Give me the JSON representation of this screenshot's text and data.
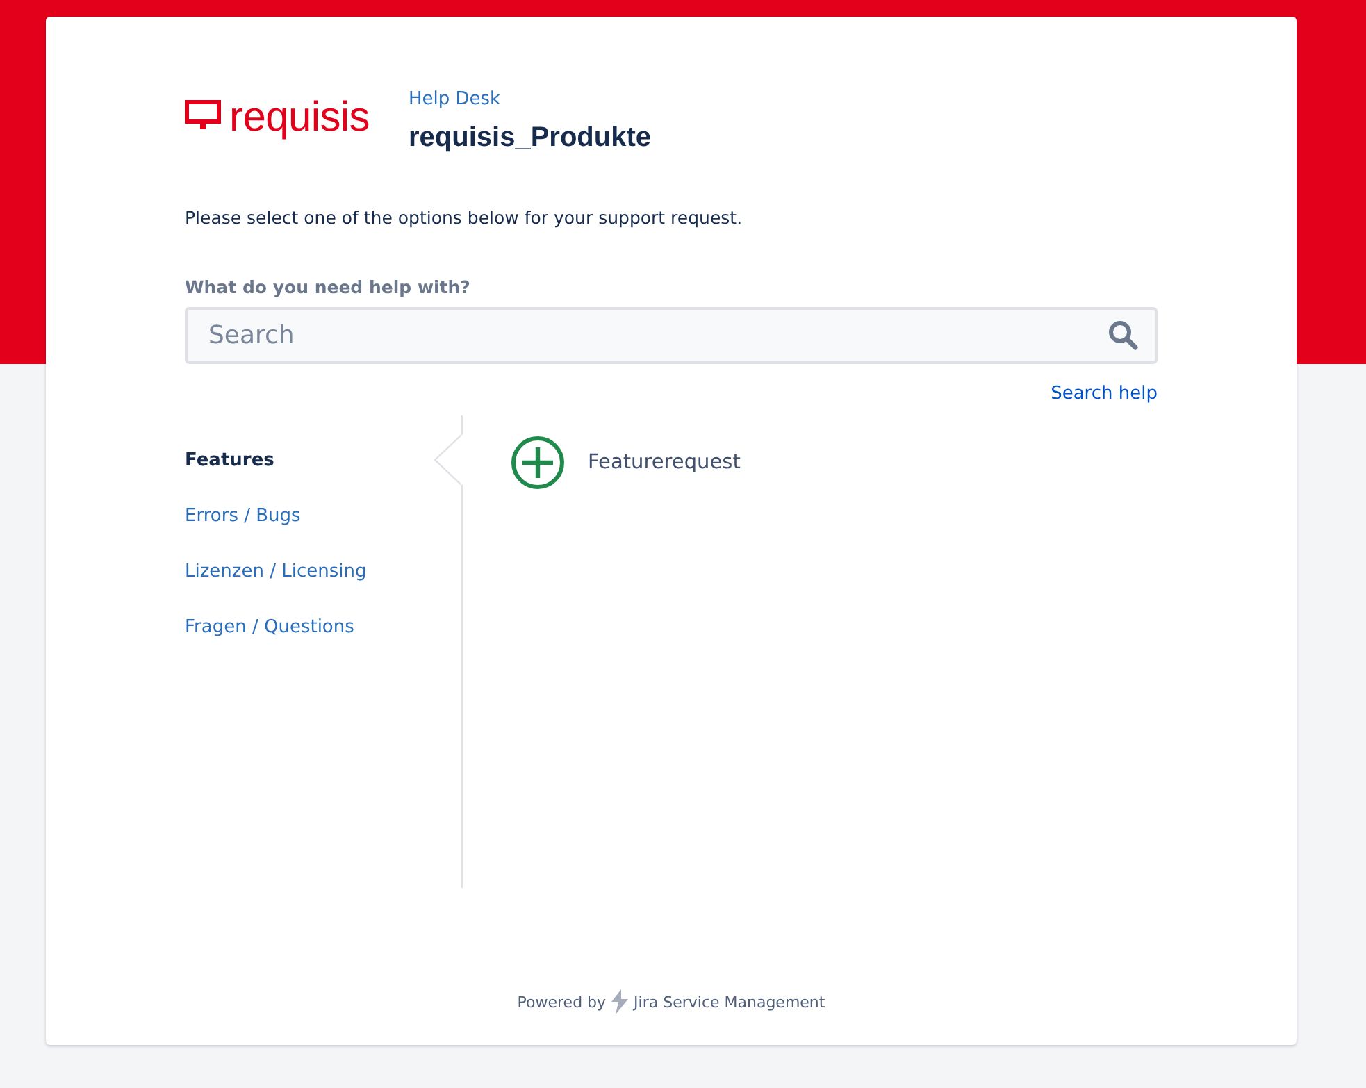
{
  "logo": {
    "text": "requisis"
  },
  "header": {
    "breadcrumb": "Help Desk",
    "title": "requisis_Produkte"
  },
  "intro": "Please select one of the options below for your support request.",
  "search": {
    "label": "What do you need help with?",
    "placeholder": "Search",
    "help_link": "Search help"
  },
  "sidebar": {
    "items": [
      {
        "label": "Features",
        "selected": true
      },
      {
        "label": "Errors / Bugs",
        "selected": false
      },
      {
        "label": "Lizenzen / Licensing",
        "selected": false
      },
      {
        "label": "Fragen / Questions",
        "selected": false
      }
    ]
  },
  "request_types": [
    {
      "label": "Featurerequest",
      "kind": "add"
    }
  ],
  "footer": {
    "prefix": "Powered by",
    "product": "Jira Service Management"
  }
}
